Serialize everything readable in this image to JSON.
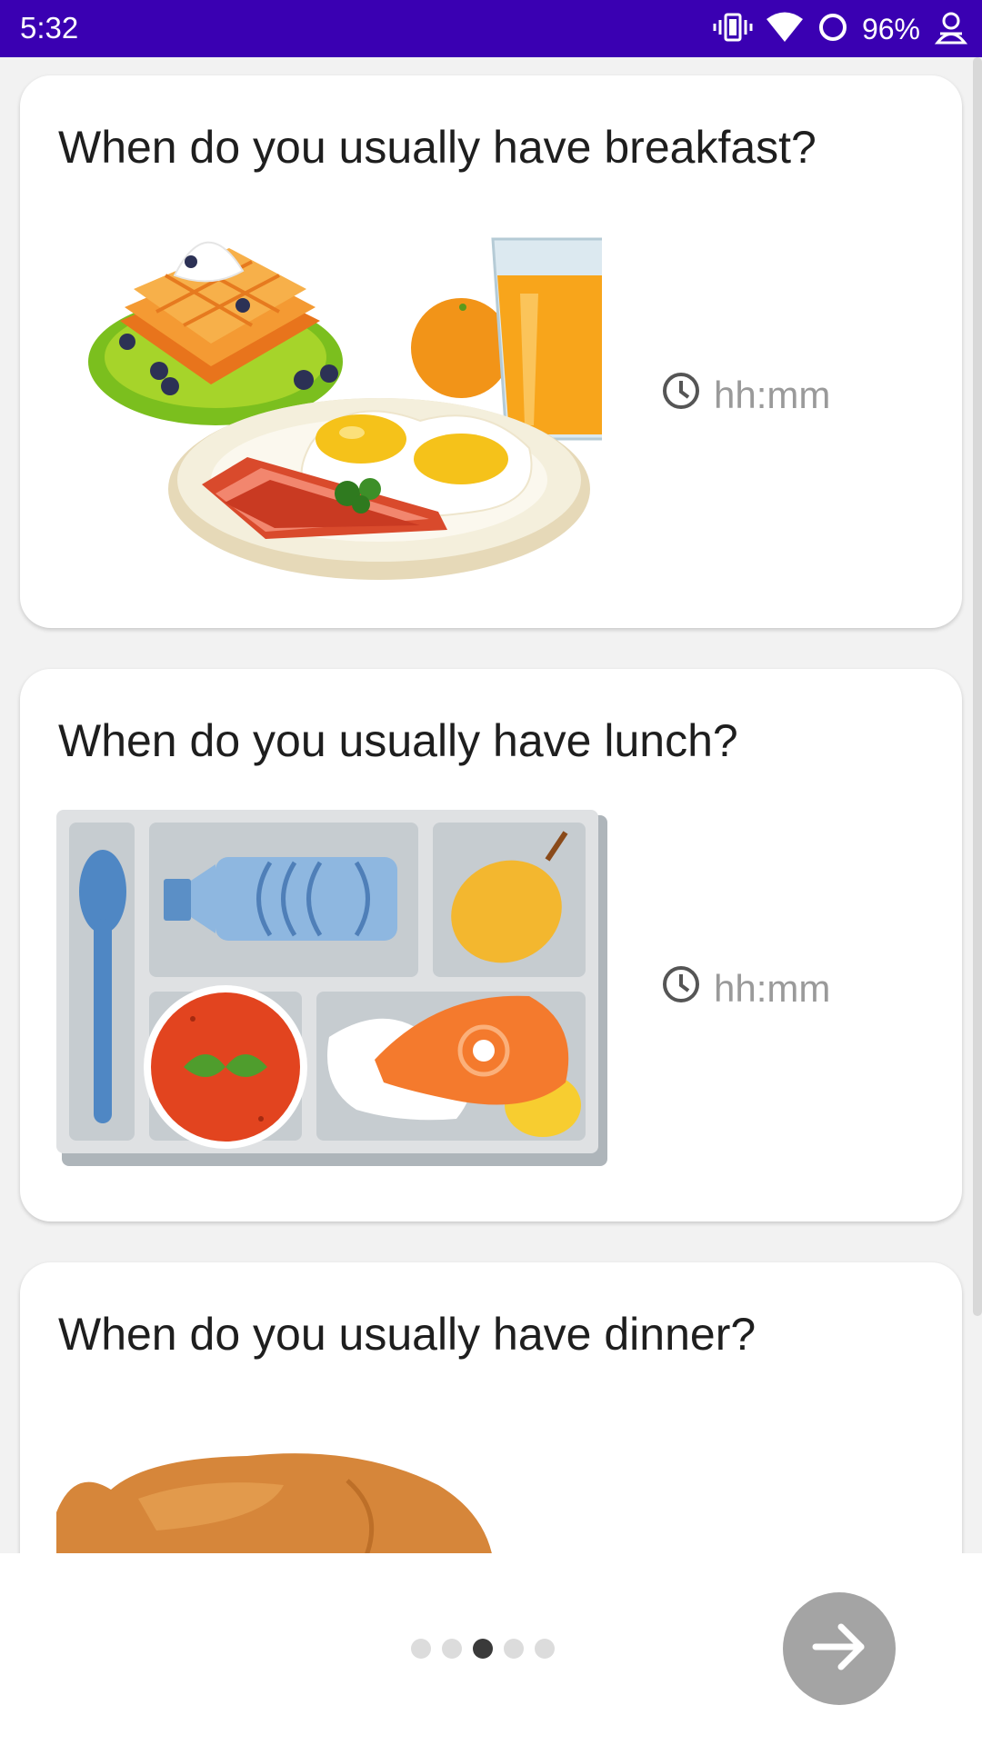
{
  "status": {
    "time": "5:32",
    "battery": "96%"
  },
  "cards": [
    {
      "question": "When do you usually have breakfast?",
      "time_placeholder": "hh:mm",
      "image_icon": "breakfast-illustration"
    },
    {
      "question": "When do you usually have lunch?",
      "time_placeholder": "hh:mm",
      "image_icon": "lunch-tray-illustration"
    },
    {
      "question": "When do you usually have dinner?",
      "image_icon": "roast-chicken-illustration"
    }
  ],
  "pager": {
    "total": 5,
    "current": 3
  },
  "next_icon": "arrow-right-icon",
  "colors": {
    "status_bar": "#3a00b2",
    "accent_gray": "#a4a4a4"
  }
}
